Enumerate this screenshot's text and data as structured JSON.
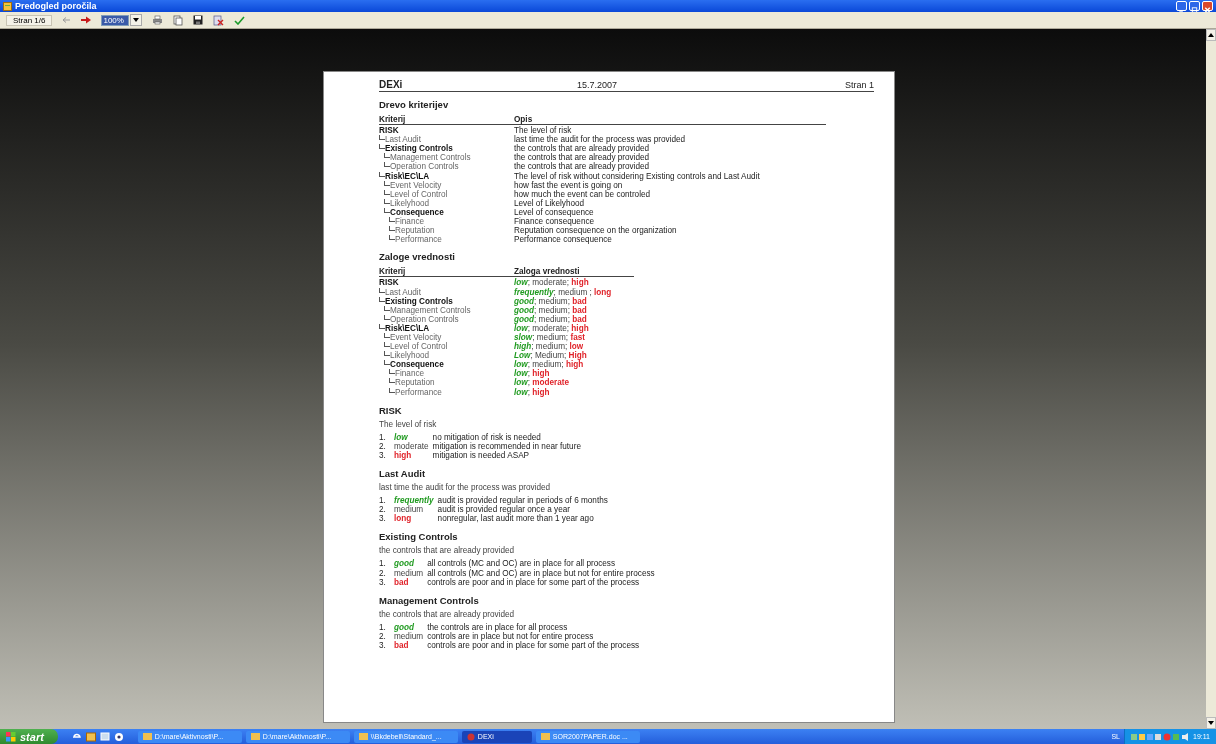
{
  "window": {
    "title": "Predogled poročila"
  },
  "toolbar": {
    "page_label": "Stran 1/6",
    "zoom": "100%"
  },
  "report": {
    "app": "DEXi",
    "date": "15.7.2007",
    "page": "Stran 1",
    "tree_section": {
      "title": "Drevo kriterijev",
      "columns": [
        "Kriterij",
        "Opis"
      ],
      "rows": [
        {
          "name": "RISK",
          "text": "The level of risk",
          "children": [
            {
              "name": "Last Audit",
              "text": "last time the audit for the process was provided"
            },
            {
              "name": "Existing Controls",
              "text": "the controls that are already provided",
              "children": [
                {
                  "name": "Management Controls",
                  "text": "the controls that are already provided"
                },
                {
                  "name": "Operation Controls",
                  "text": "the controls that are already provided"
                }
              ]
            },
            {
              "name": "Risk\\EC\\LA",
              "text": "The level of risk without considering Existing controls and Last Audit",
              "children": [
                {
                  "name": "Event Velocity",
                  "text": "how fast the event is going on"
                },
                {
                  "name": "Level of Control",
                  "text": "how much the event can be controled"
                },
                {
                  "name": "Likelyhood",
                  "text": "Level of Likelyhood"
                },
                {
                  "name": "Consequence",
                  "text": "Level of consequence",
                  "children": [
                    {
                      "name": "Finance",
                      "text": "Finance consequence"
                    },
                    {
                      "name": "Reputation",
                      "text": "Reputation consequence on the organization"
                    },
                    {
                      "name": "Performance",
                      "text": "Performance consequence"
                    }
                  ]
                }
              ]
            }
          ]
        }
      ]
    },
    "values_section": {
      "title": "Zaloge vrednosti",
      "columns": [
        "Kriterij",
        "Zaloga vrednosti"
      ],
      "rows": [
        {
          "name": "RISK",
          "values": [
            {
              "text": "low",
              "kind": "good"
            },
            {
              "text": "; moderate; ",
              "kind": "neutral"
            },
            {
              "text": "high",
              "kind": "bad"
            }
          ],
          "children": [
            {
              "name": "Last Audit",
              "values": [
                {
                  "text": "frequently",
                  "kind": "good"
                },
                {
                  "text": "; medium ; ",
                  "kind": "neutral"
                },
                {
                  "text": "long",
                  "kind": "bad"
                }
              ]
            },
            {
              "name": "Existing Controls",
              "values": [
                {
                  "text": "good",
                  "kind": "good"
                },
                {
                  "text": "; medium; ",
                  "kind": "neutral"
                },
                {
                  "text": "bad",
                  "kind": "bad"
                }
              ],
              "children": [
                {
                  "name": "Management Controls",
                  "values": [
                    {
                      "text": "good",
                      "kind": "good"
                    },
                    {
                      "text": "; medium; ",
                      "kind": "neutral"
                    },
                    {
                      "text": "bad",
                      "kind": "bad"
                    }
                  ]
                },
                {
                  "name": "Operation Controls",
                  "values": [
                    {
                      "text": "good",
                      "kind": "good"
                    },
                    {
                      "text": "; medium; ",
                      "kind": "neutral"
                    },
                    {
                      "text": "bad",
                      "kind": "bad"
                    }
                  ]
                }
              ]
            },
            {
              "name": "Risk\\EC\\LA",
              "values": [
                {
                  "text": "low",
                  "kind": "good"
                },
                {
                  "text": "; moderate; ",
                  "kind": "neutral"
                },
                {
                  "text": "high",
                  "kind": "bad"
                }
              ],
              "children": [
                {
                  "name": "Event Velocity",
                  "values": [
                    {
                      "text": "slow",
                      "kind": "good"
                    },
                    {
                      "text": "; medium; ",
                      "kind": "neutral"
                    },
                    {
                      "text": "fast",
                      "kind": "bad"
                    }
                  ]
                },
                {
                  "name": "Level of Control",
                  "values": [
                    {
                      "text": "high",
                      "kind": "good"
                    },
                    {
                      "text": "; medium; ",
                      "kind": "neutral"
                    },
                    {
                      "text": "low",
                      "kind": "bad"
                    }
                  ]
                },
                {
                  "name": "Likelyhood",
                  "values": [
                    {
                      "text": "Low",
                      "kind": "good"
                    },
                    {
                      "text": "; Medium; ",
                      "kind": "neutral"
                    },
                    {
                      "text": "High",
                      "kind": "bad"
                    }
                  ]
                },
                {
                  "name": "Consequence",
                  "values": [
                    {
                      "text": "low",
                      "kind": "good"
                    },
                    {
                      "text": "; medium; ",
                      "kind": "neutral"
                    },
                    {
                      "text": "high",
                      "kind": "bad"
                    }
                  ],
                  "children": [
                    {
                      "name": "Finance",
                      "values": [
                        {
                          "text": "low",
                          "kind": "good"
                        },
                        {
                          "text": "; ",
                          "kind": "neutral"
                        },
                        {
                          "text": "high",
                          "kind": "bad"
                        }
                      ]
                    },
                    {
                      "name": "Reputation",
                      "values": [
                        {
                          "text": "low",
                          "kind": "good"
                        },
                        {
                          "text": "; ",
                          "kind": "neutral"
                        },
                        {
                          "text": "moderate",
                          "kind": "bad"
                        }
                      ]
                    },
                    {
                      "name": "Performance",
                      "values": [
                        {
                          "text": "low",
                          "kind": "good"
                        },
                        {
                          "text": "; ",
                          "kind": "neutral"
                        },
                        {
                          "text": "high",
                          "kind": "bad"
                        }
                      ]
                    }
                  ]
                }
              ]
            }
          ]
        }
      ]
    },
    "scales": [
      {
        "title": "RISK",
        "description": "The level of risk",
        "items": [
          {
            "number": "1.",
            "value": "low",
            "kind": "good",
            "text": "no mitigation of risk is needed"
          },
          {
            "number": "2.",
            "value": "moderate",
            "kind": "neutral",
            "text": "mitigation is recommended in near future"
          },
          {
            "number": "3.",
            "value": "high",
            "kind": "bad",
            "text": "mitigation is needed ASAP"
          }
        ]
      },
      {
        "title": "Last Audit",
        "description": "last time the audit for the process was provided",
        "items": [
          {
            "number": "1.",
            "value": "frequently",
            "kind": "good",
            "text": "audit is provided regular in periods of 6 months"
          },
          {
            "number": "2.",
            "value": "medium",
            "kind": "neutral",
            "text": "audit is provided regular once a year"
          },
          {
            "number": "3.",
            "value": "long",
            "kind": "bad",
            "text": "nonregular, last audit more than 1 year ago"
          }
        ]
      },
      {
        "title": "Existing Controls",
        "description": "the controls that are already provided",
        "items": [
          {
            "number": "1.",
            "value": "good",
            "kind": "good",
            "text": "all controls (MC and OC) are in place for all process"
          },
          {
            "number": "2.",
            "value": "medium",
            "kind": "neutral",
            "text": "all controls (MC and OC) are in place but not for entire process"
          },
          {
            "number": "3.",
            "value": "bad",
            "kind": "bad",
            "text": "controls are poor and in place for some part of the process"
          }
        ]
      },
      {
        "title": "Management Controls",
        "description": "the controls that are already provided",
        "items": [
          {
            "number": "1.",
            "value": "good",
            "kind": "good",
            "text": "the controls are in place for all process"
          },
          {
            "number": "2.",
            "value": "medium",
            "kind": "neutral",
            "text": "controls are in place but not for entire process"
          },
          {
            "number": "3.",
            "value": "bad",
            "kind": "bad",
            "text": "controls are poor and in place for some part of the process"
          }
        ]
      }
    ]
  },
  "taskbar": {
    "start": "start",
    "tasks": [
      {
        "label": "D:\\mare\\Aktivnosti\\P...",
        "selected": false
      },
      {
        "label": "D:\\mare\\Aktivnosti\\P...",
        "selected": false
      },
      {
        "label": "\\\\Bkdebell\\Standard_...",
        "selected": false
      },
      {
        "label": "DEXi",
        "selected": true
      },
      {
        "label": "SOR2007PAPER.doc ...",
        "selected": false
      }
    ],
    "language": "SL",
    "time": "19:11"
  }
}
